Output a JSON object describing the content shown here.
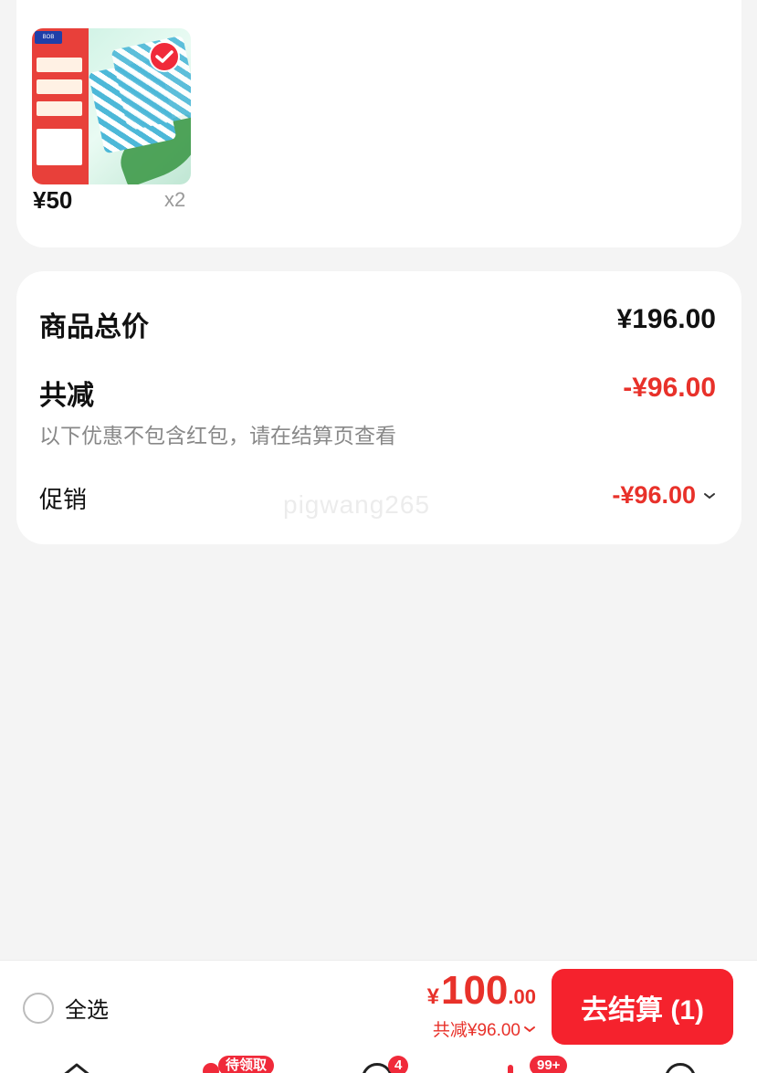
{
  "product": {
    "price": "¥50",
    "quantity": "x2",
    "image_label": "BOBDOG product image"
  },
  "summary": {
    "total_label": "商品总价",
    "total_value": "¥196.00",
    "discount_label": "共减",
    "discount_value": "-¥96.00",
    "note": "以下优惠不包含红包，请在结算页查看",
    "promo_label": "促销",
    "promo_value": "-¥96.00"
  },
  "watermark": "pigwang265",
  "bottom_bar": {
    "select_all_label": "全选",
    "currency": "¥",
    "total_int": "100",
    "total_dec": ".00",
    "discount_text": "共减¥96.00",
    "checkout_label": "去结算 (1)"
  },
  "tabbar": {
    "badges": [
      "待领取",
      "4",
      "99+"
    ]
  },
  "colors": {
    "accent": "#f5222d",
    "price_red": "#e8312a",
    "background": "#f4f4f4"
  }
}
